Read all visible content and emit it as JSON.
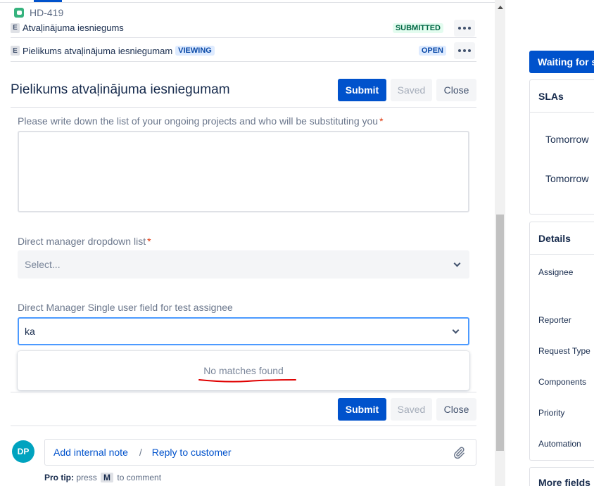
{
  "issue_key": "HD-419",
  "forms": [
    {
      "type_badge": "E",
      "name": "Atvaļinājuma iesniegums",
      "status": "SUBMITTED"
    },
    {
      "type_badge": "E",
      "name": "Pielikums atvaļinājuma iesniegumam",
      "badge": "VIEWING",
      "status": "OPEN"
    }
  ],
  "form": {
    "title": "Pielikums atvaļinājuma iesniegumam",
    "submit_label": "Submit",
    "saved_label": "Saved",
    "close_label": "Close",
    "fields": {
      "projects_label": "Please write down the list of your ongoing projects and who will be substituting you",
      "manager_dropdown_label": "Direct manager dropdown list",
      "manager_dropdown_placeholder": "Select...",
      "manager_user_label": "Direct Manager Single user field for test assignee",
      "manager_user_value": "ka",
      "no_matches": "No matches found",
      "required_mark": "*"
    }
  },
  "comment": {
    "avatar_initials": "DP",
    "add_internal_note": "Add internal note",
    "separator": "/",
    "reply_to_customer": "Reply to customer",
    "protip_label": "Pro tip:",
    "protip_press": "press",
    "protip_key": "M",
    "protip_suffix": "to comment"
  },
  "right_panel": {
    "status_button": "Waiting for s",
    "slas_title": "SLAs",
    "sla_items": [
      "Tomorrow",
      "Tomorrow"
    ],
    "details_title": "Details",
    "detail_fields": [
      "Assignee",
      "Reporter",
      "Request Type",
      "Components",
      "Priority",
      "Automation"
    ],
    "more_fields": "More fields"
  },
  "colors": {
    "primary": "#0052cc",
    "status_green": "#006644",
    "annotation_red": "#e00000"
  }
}
